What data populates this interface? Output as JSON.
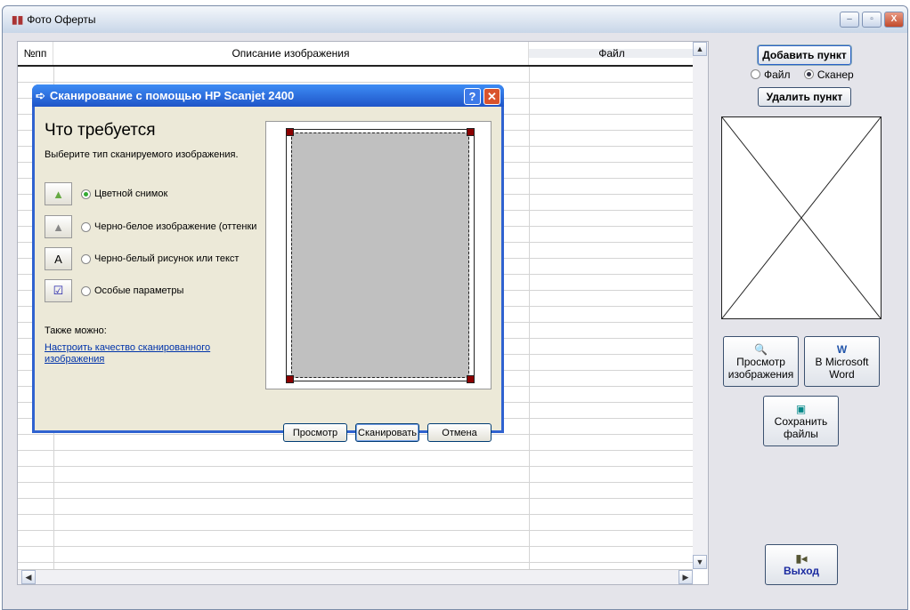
{
  "window": {
    "title": "Фото Оферты",
    "min": "–",
    "max": "▫",
    "close": "X"
  },
  "grid": {
    "columns": [
      "№пп",
      "Описание изображения",
      "Файл"
    ],
    "scroll_up": "▲",
    "scroll_down": "▼",
    "scroll_left": "◀",
    "scroll_right": "▶"
  },
  "right": {
    "add": "Добавить пункт",
    "source_file": "Файл",
    "source_scanner": "Сканер",
    "source_selected": "Сканер",
    "delete": "Удалить пункт",
    "preview": [
      "Просмотр",
      "изображения"
    ],
    "word": [
      "В Microsoft",
      "Word"
    ],
    "save": [
      "Сохранить",
      "файлы"
    ],
    "exit": "Выход"
  },
  "dialog": {
    "title": "Сканирование с помощью HP Scanjet 2400",
    "help": "?",
    "close": "✕",
    "heading": "Что требуется",
    "subtitle": "Выберите тип сканируемого изображения.",
    "options": [
      "Цветной снимок",
      "Черно-белое изображение (оттенки",
      "Черно-белый рисунок или текст",
      "Особые параметры"
    ],
    "selected": 0,
    "also": "Также можно:",
    "link": "Настроить качество сканированного изображения",
    "buttons": {
      "preview": "Просмотр",
      "scan": "Сканировать",
      "cancel": "Отмена"
    }
  }
}
